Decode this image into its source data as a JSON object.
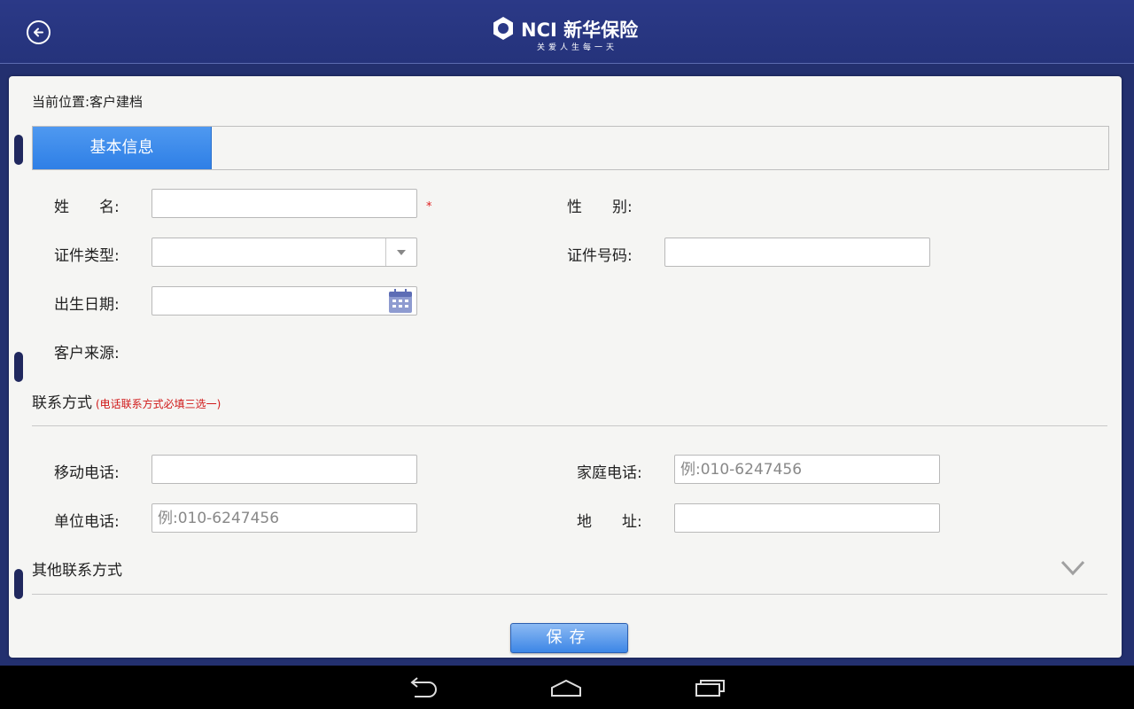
{
  "header": {
    "logo_text": "NCI 新华保险",
    "logo_slogan": "关爱人生每一天"
  },
  "breadcrumb": "当前位置:客户建档",
  "tabs": [
    {
      "label": "基本信息",
      "active": true
    }
  ],
  "basic_info": {
    "name_label": "姓　　名:",
    "name_value": "",
    "required_mark": "*",
    "gender_label": "性　　别:",
    "id_type_label": "证件类型:",
    "id_type_value": "",
    "id_number_label": "证件号码:",
    "id_number_value": "",
    "birth_date_label": "出生日期:",
    "birth_date_value": "",
    "source_label": "客户来源:"
  },
  "contact": {
    "title": "联系方式",
    "hint": "(电话联系方式必填三选一)",
    "mobile_label": "移动电话:",
    "mobile_value": "",
    "home_phone_label": "家庭电话:",
    "home_phone_placeholder": "例:010-6247456",
    "work_phone_label": "单位电话:",
    "work_phone_placeholder": "例:010-6247456",
    "address_label": "地　　址:",
    "address_value": ""
  },
  "other_contact": {
    "title": "其他联系方式"
  },
  "save_label": "保存",
  "colors": {
    "header_bg": "#2b3987",
    "tab_active": "#3c8aeb",
    "required": "#e02020",
    "panel_bg": "#f5f5f3"
  },
  "icons": {
    "back": "back-arrow-icon",
    "calendar": "calendar-icon",
    "dropdown": "dropdown-arrow-icon",
    "expand": "chevron-down-icon",
    "nav_back": "nav-back-icon",
    "nav_home": "nav-home-icon",
    "nav_recents": "nav-recents-icon"
  }
}
